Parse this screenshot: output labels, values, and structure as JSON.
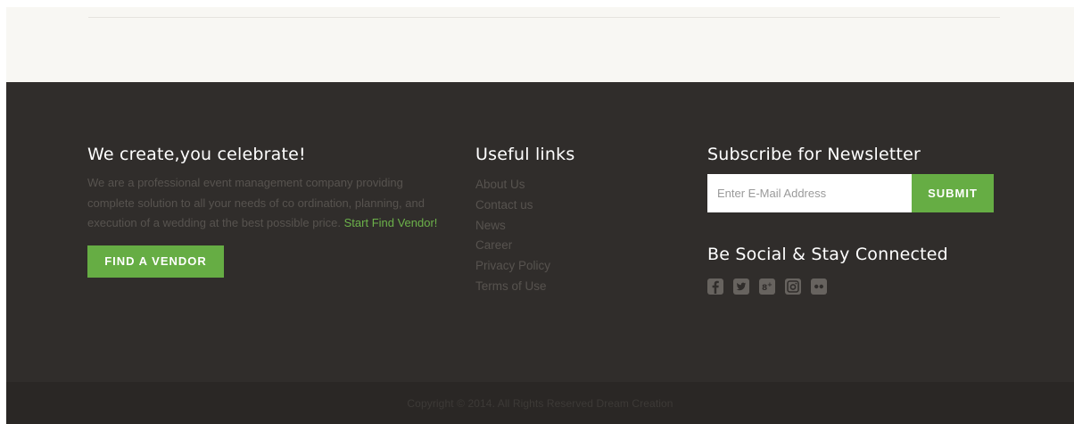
{
  "about": {
    "heading": "We create,you celebrate!",
    "description": "We are a professional event management company providing complete solution to all your needs of co ordination, planning, and execution of a wedding at the best possible price.",
    "link_text": "Start Find Vendor!",
    "button_label": "FIND A VENDOR"
  },
  "links": {
    "heading": "Useful links",
    "items": [
      {
        "label": "About Us"
      },
      {
        "label": "Contact us"
      },
      {
        "label": "News"
      },
      {
        "label": "Career"
      },
      {
        "label": "Privacy Policy"
      },
      {
        "label": "Terms of Use"
      }
    ]
  },
  "newsletter": {
    "heading": "Subscribe for Newsletter",
    "email_placeholder": "Enter E-Mail Address",
    "email_value": "",
    "submit_label": "SUBMIT"
  },
  "social": {
    "heading": "Be Social & Stay Connected",
    "icons": [
      "facebook-icon",
      "twitter-icon",
      "google-plus-icon",
      "instagram-icon",
      "flickr-icon"
    ]
  },
  "copyright": "Copyright © 2014. All Rights Reserved Dream Creation",
  "colors": {
    "accent": "#66ad44",
    "footer_bg": "#302d2b",
    "bottom_bar_bg": "#2a2725",
    "top_band_bg": "#f8f7f3",
    "muted_text": "#57534f"
  }
}
